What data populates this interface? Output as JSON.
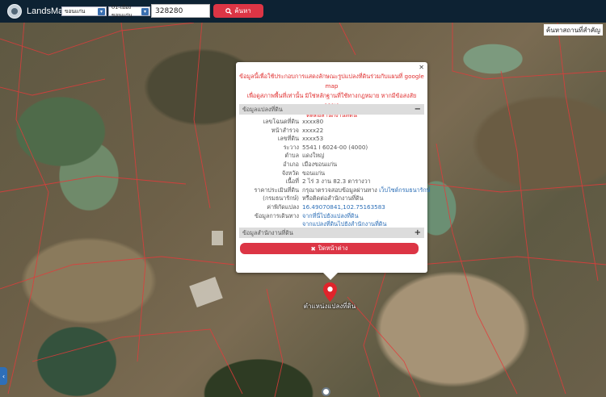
{
  "app": {
    "title": "LandsMaps"
  },
  "search": {
    "province": "ขอนแก่น",
    "district": "01-เมืองขอนแก่น",
    "parcel_number": "328280",
    "button_label": "ค้นหา"
  },
  "places_button": "ค้นหาสถานที่สำคัญ",
  "marker": {
    "label": "ตำแหน่งแปลงที่ดิน"
  },
  "popup": {
    "notice_line1": "ข้อมูลนี้เพื่อใช้ประกอบการแสดงลักษณะรูปแปลงที่ดินร่วมกับแผนที่ google map",
    "notice_line2": "เพื่อดูสภาพพื้นที่เท่านั้น มิใช่หลักฐานที่ใช้ทางกฎหมาย หากมีข้อสงสัย กรุณา",
    "notice_line3": "ติดต่อสำนักงานที่ดิน",
    "section1": {
      "title": "ข้อมูลแปลงที่ดิน",
      "toggle": "−"
    },
    "rows": [
      {
        "label": "เลขโฉนดที่ดิน",
        "value": "xxxx80"
      },
      {
        "label": "หน้าสำรวจ",
        "value": "xxxx22"
      },
      {
        "label": "เลขที่ดิน",
        "value": "xxxx53"
      },
      {
        "label": "ระวาง",
        "value": "5541 I 6024-00 (4000)"
      },
      {
        "label": "ตำบล",
        "value": "แดงใหญ่"
      },
      {
        "label": "อำเภอ",
        "value": "เมืองขอนแก่น"
      },
      {
        "label": "จังหวัด",
        "value": "ขอนแก่น"
      },
      {
        "label": "เนื้อที่",
        "value": "2 ไร่ 3 งาน 82.3 ตารางวา"
      },
      {
        "label": "ราคาประเมินที่ดิน",
        "value": "กรุณาตรวจสอบข้อมูลผ่านทาง",
        "link": "เว็บไซต์กรมธนารักษ์"
      },
      {
        "label": "(กรมธนารักษ์)",
        "value": "หรือติดต่อสำนักงานที่ดิน"
      },
      {
        "label": "ค่าพิกัดแปลง",
        "link": "16.49070841,102.75163583"
      },
      {
        "label": "ข้อมูลการเดินทาง",
        "link": "จากที่นี่ไปยังแปลงที่ดิน"
      },
      {
        "label": "",
        "link": "จากแปลงที่ดินไปยังสำนักงานที่ดิน"
      }
    ],
    "section2": {
      "title": "ข้อมูลสำนักงานที่ดิน",
      "toggle": "+"
    },
    "close_button": "ปิดหน้าต่าง"
  },
  "icons": {
    "logo": "landsmaps-logo-icon",
    "search": "magnifier-icon",
    "close": "x-icon",
    "marker": "map-pin-icon",
    "side": "chevron-left-icon",
    "gps": "location-dot-icon"
  },
  "colors": {
    "topbar": "#0d2233",
    "accent": "#dc3545",
    "notice": "#e03030",
    "link": "#2d6fb7"
  }
}
